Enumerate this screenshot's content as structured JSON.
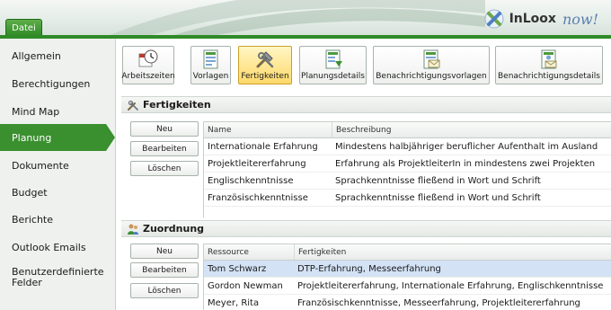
{
  "header": {
    "file_tab": "Datei",
    "logo_in": "InLoox",
    "logo_now": "now!"
  },
  "sidebar": {
    "items": [
      {
        "label": "Allgemein"
      },
      {
        "label": "Berechtigungen"
      },
      {
        "label": "Mind Map"
      },
      {
        "label": "Planung",
        "active": true
      },
      {
        "label": "Dokumente"
      },
      {
        "label": "Budget"
      },
      {
        "label": "Berichte"
      },
      {
        "label": "Outlook Emails"
      },
      {
        "label": "Benutzerdefinierte Felder"
      }
    ]
  },
  "toolbar": {
    "buttons": [
      {
        "label": "Arbeitszeiten",
        "icon": "clock-calendar-icon"
      },
      {
        "label": "Vorlagen",
        "icon": "template-icon"
      },
      {
        "label": "Fertigkeiten",
        "icon": "tools-icon",
        "active": true
      },
      {
        "label": "Planungsdetails",
        "icon": "planning-details-icon"
      },
      {
        "label": "Benachrichtigungsvorlagen",
        "icon": "notification-template-icon"
      },
      {
        "label": "Benachrichtigungsdetails",
        "icon": "notification-details-icon"
      }
    ]
  },
  "skills": {
    "title": "Fertigkeiten",
    "buttons": {
      "new": "Neu",
      "edit": "Bearbeiten",
      "delete": "Löschen"
    },
    "columns": [
      "Name",
      "Beschreibung"
    ],
    "rows": [
      [
        "Internationale Erfahrung",
        "Mindestens halbjähriger beruflicher Aufenthalt im Ausland"
      ],
      [
        "Projektleitererfahrung",
        "Erfahrung als ProjektleiterIn in mindestens zwei Projekten"
      ],
      [
        "Englischkenntnisse",
        "Sprachkenntnisse fließend in Wort und Schrift"
      ],
      [
        "Französischkenntnisse",
        "Sprachkenntnisse fließend in Wort und Schrift"
      ]
    ]
  },
  "assignment": {
    "title": "Zuordnung",
    "buttons": {
      "new": "Neu",
      "edit": "Bearbeiten",
      "delete": "Löschen"
    },
    "columns": [
      "Ressource",
      "Fertigkeiten"
    ],
    "rows": [
      [
        "Tom Schwarz",
        "DTP-Erfahrung, Messeerfahrung"
      ],
      [
        "Gordon Newman",
        "Projektleitererfahrung, Internationale Erfahrung, Englischkenntnisse"
      ],
      [
        "Meyer, Rita",
        "Französischkenntnisse, Messeerfahrung, Projektleitererfahrung"
      ]
    ],
    "selected_row": 0
  },
  "colors": {
    "accent_green": "#3a8f2f",
    "selection_blue": "#d3e2f5",
    "active_tool": "#ffd96a"
  }
}
